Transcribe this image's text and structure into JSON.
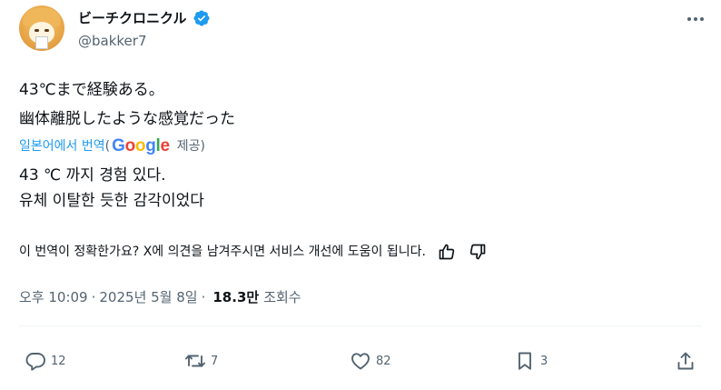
{
  "author": {
    "display_name": "ビーチクロニクル",
    "handle": "@bakker7",
    "verified": true
  },
  "tweet": {
    "text": "43℃まで経験ある。\n幽体離脱したような感覚だった"
  },
  "translation": {
    "link_label": "일본어에서 번역",
    "paren_open": "(",
    "provider_letters": [
      "G",
      "o",
      "o",
      "g",
      "l",
      "e"
    ],
    "provider_colors": [
      "#4285f4",
      "#ea4335",
      "#fbbc05",
      "#4285f4",
      "#34a853",
      "#ea4335"
    ],
    "provided_label": "제공)",
    "translated_text": "43 ℃ 까지 경험 있다.\n유체 이탈한 듯한 감각이었다",
    "feedback_prompt": "이 번역이 정확한가요? X에 의견을 남겨주시면 서비스 개선에 도움이 됩니다."
  },
  "meta": {
    "time": "오후 10:09",
    "separator": "·",
    "date": "2025년 5월 8일",
    "views_count": "18.3만",
    "views_label": "조회수"
  },
  "actions": {
    "replies": "12",
    "reposts": "7",
    "likes": "82",
    "bookmarks": "3"
  },
  "icons": [
    "more-icon",
    "verified-badge-icon",
    "thumbs-up-icon",
    "thumbs-down-icon",
    "reply-icon",
    "repost-icon",
    "like-icon",
    "bookmark-icon",
    "share-icon"
  ],
  "colors": {
    "accent": "#1d9bf0",
    "text": "#0f1419",
    "secondary_text": "#536471"
  }
}
